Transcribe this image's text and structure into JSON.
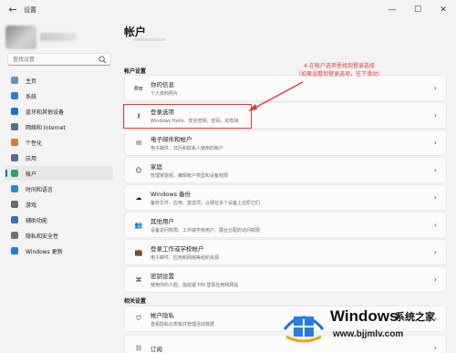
{
  "window": {
    "title": "设置",
    "controls": [
      "—",
      "☐",
      "✕"
    ]
  },
  "search": {
    "placeholder": "查找设置"
  },
  "sidebar": {
    "items": [
      {
        "label": "主页",
        "color": "#6b8fb5"
      },
      {
        "label": "系统",
        "color": "#2f7cd1"
      },
      {
        "label": "蓝牙和其他设备",
        "color": "#1f6fd8"
      },
      {
        "label": "网络和 Internet",
        "color": "#5a6f8a"
      },
      {
        "label": "个性化",
        "color": "#d77b3a"
      },
      {
        "label": "应用",
        "color": "#5b6e86"
      },
      {
        "label": "帐户",
        "color": "#2fa56e",
        "active": true
      },
      {
        "label": "时间和语言",
        "color": "#2f87c9"
      },
      {
        "label": "游戏",
        "color": "#6a6a6a"
      },
      {
        "label": "辅助功能",
        "color": "#3a6fb8"
      },
      {
        "label": "隐私和安全性",
        "color": "#717171"
      },
      {
        "label": "Windows 更新",
        "color": "#1f7dd6"
      }
    ]
  },
  "main": {
    "title": "帐户",
    "section_account": "帐户设置",
    "section_related": "相关设置",
    "cards": [
      {
        "title": "你的信息",
        "sub": "个人资料照片"
      },
      {
        "title": "登录选项",
        "sub": "Windows Hello、安全密钥、密码、动态锁"
      },
      {
        "title": "电子邮件和帐户",
        "sub": "电子邮件、日历和联系人使用的帐户"
      },
      {
        "title": "家庭",
        "sub": "管理家庭组、编辑帐户类型和设备权限"
      },
      {
        "title": "Windows 备份",
        "sub": "备份文件、应用、首选项，以便在多个设备上还原它们"
      },
      {
        "title": "其他用户",
        "sub": "设备访问权限、工作或学校用户、展台分配的访问权限"
      },
      {
        "title": "登录工作或学校帐户",
        "sub": "电子邮件、应用和网络等组织资源"
      },
      {
        "title": "密钥设置",
        "sub": "使用你的人脸、指纹或 PIN 登录应用和网站"
      }
    ],
    "related": [
      {
        "title": "帐户隐私",
        "sub": "查看隐私仪表板并管理活动数据"
      },
      {
        "title": "订阅",
        "sub": ""
      }
    ]
  },
  "annotation": {
    "line1": "4.在帐户选项里找到登录选择",
    "line2": "（如果没看到登录选项，往下滑动）",
    "color": "#e23b3b"
  },
  "watermark": {
    "brand": "Windows",
    "cn": "系统之家",
    "url": "www.bjjmlv.com"
  }
}
